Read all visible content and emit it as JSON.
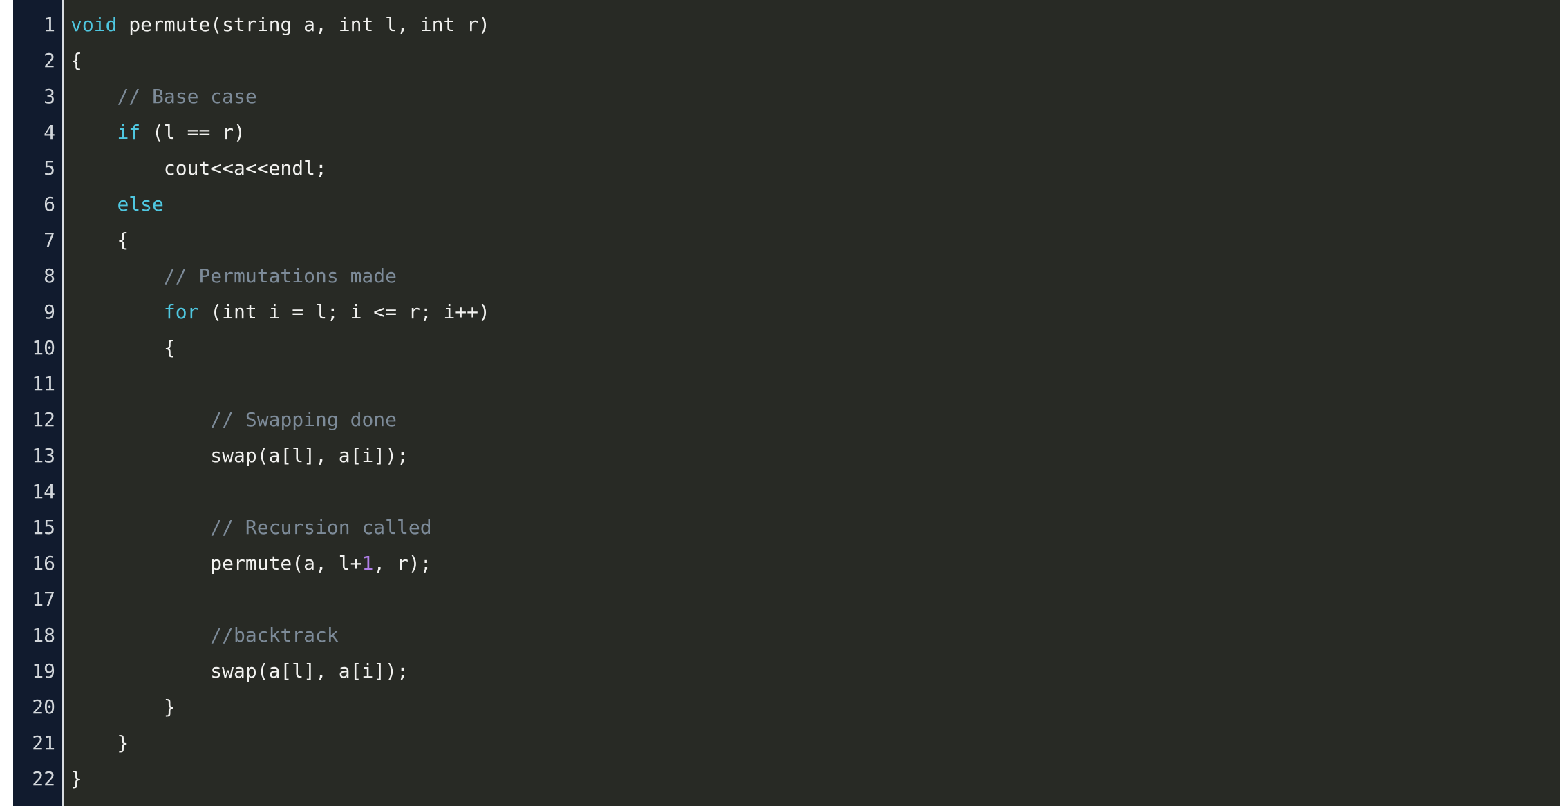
{
  "editor": {
    "language": "cpp",
    "total_lines": 22,
    "theme": {
      "gutter_background": "#111b2e",
      "gutter_text": "#d2d6da",
      "gutter_separator": "#d8dce0",
      "code_background": "#282a25",
      "default_text": "#f2f2f0",
      "keyword": "#4fc7e0",
      "comment": "#7d8b99",
      "number": "#b07fe8",
      "page_background": "#ffffff"
    }
  },
  "line_numbers": [
    "1",
    "2",
    "3",
    "4",
    "5",
    "6",
    "7",
    "8",
    "9",
    "10",
    "11",
    "12",
    "13",
    "14",
    "15",
    "16",
    "17",
    "18",
    "19",
    "20",
    "21",
    "22"
  ],
  "code": {
    "plain_text": "void permute(string a, int l, int r)\n{\n    // Base case\n    if (l == r)\n        cout<<a<<endl;\n    else\n    {\n        // Permutations made\n        for (int i = l; i <= r; i++)\n        {\n\n            // Swapping done\n            swap(a[l], a[i]);\n\n            // Recursion called\n            permute(a, l+1, r);\n\n            //backtrack\n            swap(a[l], a[i]);\n        }\n    }\n}",
    "lines": [
      {
        "number": "1",
        "tokens": [
          {
            "t": "void",
            "c": "kw"
          },
          {
            "t": " permute(string a, int l, int r)",
            "c": "txt"
          }
        ]
      },
      {
        "number": "2",
        "tokens": [
          {
            "t": "{",
            "c": "txt"
          }
        ]
      },
      {
        "number": "3",
        "tokens": [
          {
            "t": "    ",
            "c": "txt"
          },
          {
            "t": "// Base case",
            "c": "cmt"
          }
        ]
      },
      {
        "number": "4",
        "tokens": [
          {
            "t": "    ",
            "c": "txt"
          },
          {
            "t": "if",
            "c": "kw"
          },
          {
            "t": " (l == r)",
            "c": "txt"
          }
        ]
      },
      {
        "number": "5",
        "tokens": [
          {
            "t": "        cout<<a<<endl;",
            "c": "txt"
          }
        ]
      },
      {
        "number": "6",
        "tokens": [
          {
            "t": "    ",
            "c": "txt"
          },
          {
            "t": "else",
            "c": "kw"
          }
        ]
      },
      {
        "number": "7",
        "tokens": [
          {
            "t": "    {",
            "c": "txt"
          }
        ]
      },
      {
        "number": "8",
        "tokens": [
          {
            "t": "        ",
            "c": "txt"
          },
          {
            "t": "// Permutations made",
            "c": "cmt"
          }
        ]
      },
      {
        "number": "9",
        "tokens": [
          {
            "t": "        ",
            "c": "txt"
          },
          {
            "t": "for",
            "c": "kw"
          },
          {
            "t": " (int i = l; i <= r; i++)",
            "c": "txt"
          }
        ]
      },
      {
        "number": "10",
        "tokens": [
          {
            "t": "        {",
            "c": "txt"
          }
        ]
      },
      {
        "number": "11",
        "tokens": [
          {
            "t": "",
            "c": "txt"
          }
        ]
      },
      {
        "number": "12",
        "tokens": [
          {
            "t": "            ",
            "c": "txt"
          },
          {
            "t": "// Swapping done",
            "c": "cmt"
          }
        ]
      },
      {
        "number": "13",
        "tokens": [
          {
            "t": "            swap(a[l], a[i]);",
            "c": "txt"
          }
        ]
      },
      {
        "number": "14",
        "tokens": [
          {
            "t": "",
            "c": "txt"
          }
        ]
      },
      {
        "number": "15",
        "tokens": [
          {
            "t": "            ",
            "c": "txt"
          },
          {
            "t": "// Recursion called",
            "c": "cmt"
          }
        ]
      },
      {
        "number": "16",
        "tokens": [
          {
            "t": "            permute(a, l+",
            "c": "txt"
          },
          {
            "t": "1",
            "c": "num"
          },
          {
            "t": ", r);",
            "c": "txt"
          }
        ]
      },
      {
        "number": "17",
        "tokens": [
          {
            "t": "",
            "c": "txt"
          }
        ]
      },
      {
        "number": "18",
        "tokens": [
          {
            "t": "            ",
            "c": "txt"
          },
          {
            "t": "//backtrack",
            "c": "cmt"
          }
        ]
      },
      {
        "number": "19",
        "tokens": [
          {
            "t": "            swap(a[l], a[i]);",
            "c": "txt"
          }
        ]
      },
      {
        "number": "20",
        "tokens": [
          {
            "t": "        }",
            "c": "txt"
          }
        ]
      },
      {
        "number": "21",
        "tokens": [
          {
            "t": "    }",
            "c": "txt"
          }
        ]
      },
      {
        "number": "22",
        "tokens": [
          {
            "t": "}",
            "c": "txt"
          }
        ]
      }
    ]
  }
}
